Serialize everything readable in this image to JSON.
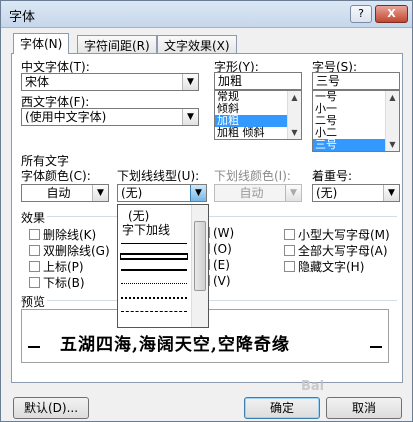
{
  "window": {
    "title": "字体",
    "help_label": "?",
    "close_label": "X"
  },
  "tabs": [
    {
      "label": "字体(N)",
      "active": true
    },
    {
      "label": "字符间距(R)",
      "active": false
    },
    {
      "label": "文字效果(X)",
      "active": false
    }
  ],
  "font": {
    "cn_font_label": "中文字体(T):",
    "cn_font_value": "宋体",
    "west_font_label": "西文字体(F):",
    "west_font_value": "(使用中文字体)",
    "style_label": "字形(Y):",
    "style_value": "加粗",
    "style_options": [
      "常规",
      "倾斜",
      "加粗",
      "加粗 倾斜"
    ],
    "style_selected_index": 2,
    "size_label": "字号(S):",
    "size_value": "三号",
    "size_options": [
      "一号",
      "小一",
      "二号",
      "小二",
      "三号"
    ],
    "size_selected_index": 4
  },
  "all_text": {
    "section_label": "所有文字",
    "color_label": "字体颜色(C):",
    "color_value": "自动",
    "underline_label": "下划线线型(U):",
    "underline_value": "(无)",
    "underline_color_label": "下划线颜色(I):",
    "underline_color_value": "自动",
    "emphasis_label": "着重号:",
    "emphasis_value": "(无)"
  },
  "underline_dropdown": {
    "options": [
      "(无)",
      "字下加线"
    ]
  },
  "effects": {
    "section_label": "效果",
    "left": [
      "删除线(K)",
      "双删除线(G)",
      "上标(P)",
      "下标(B)"
    ],
    "middle": [
      "(W)",
      "(O)",
      "(E)",
      "(V)"
    ],
    "right": [
      "小型大写字母(M)",
      "全部大写字母(A)",
      "隐藏文字(H)"
    ]
  },
  "preview": {
    "section_label": "预览",
    "sample_text": "五湖四海,海阔天空,空降奇缘"
  },
  "buttons": {
    "default": "默认(D)...",
    "ok": "确定",
    "cancel": "取消"
  },
  "watermark": "Bai"
}
